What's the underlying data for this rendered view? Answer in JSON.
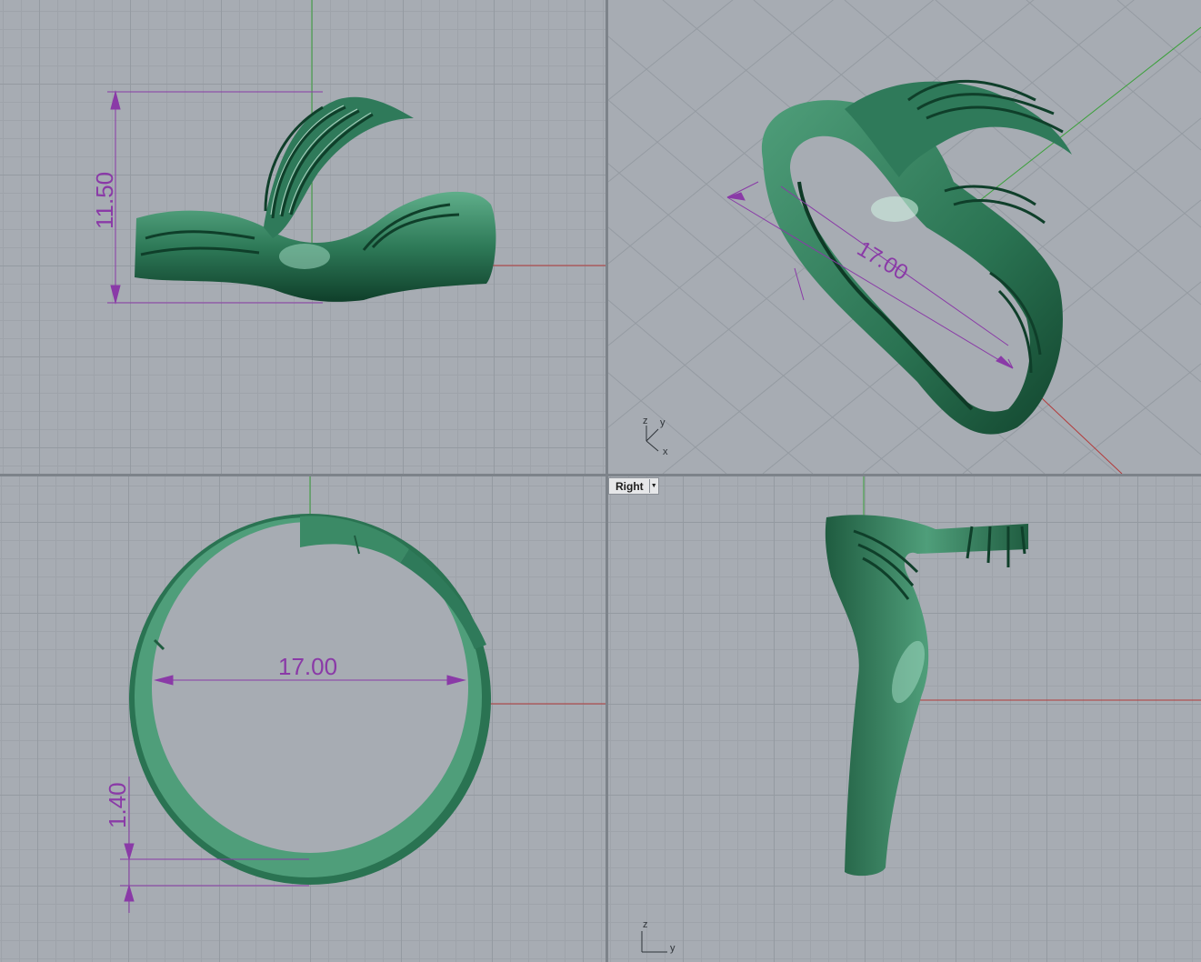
{
  "viewports": {
    "front": {
      "dimension": "11.50"
    },
    "perspective": {
      "dimension": "17.00",
      "axis_icon": {
        "z": "z",
        "y": "y",
        "x": "x"
      }
    },
    "top": {
      "dimension_width": "17.00",
      "dimension_thickness": "1.40"
    },
    "right": {
      "tab_label": "Right",
      "axis_icon": {
        "z": "z",
        "y": "y"
      }
    }
  },
  "colors": {
    "model": "#2f7a5a",
    "dimension": "#8a3aa7",
    "x_axis": "#b33a3a",
    "y_axis": "#3aa03a"
  },
  "icons": {
    "dropdown": "chevron-down-icon"
  }
}
